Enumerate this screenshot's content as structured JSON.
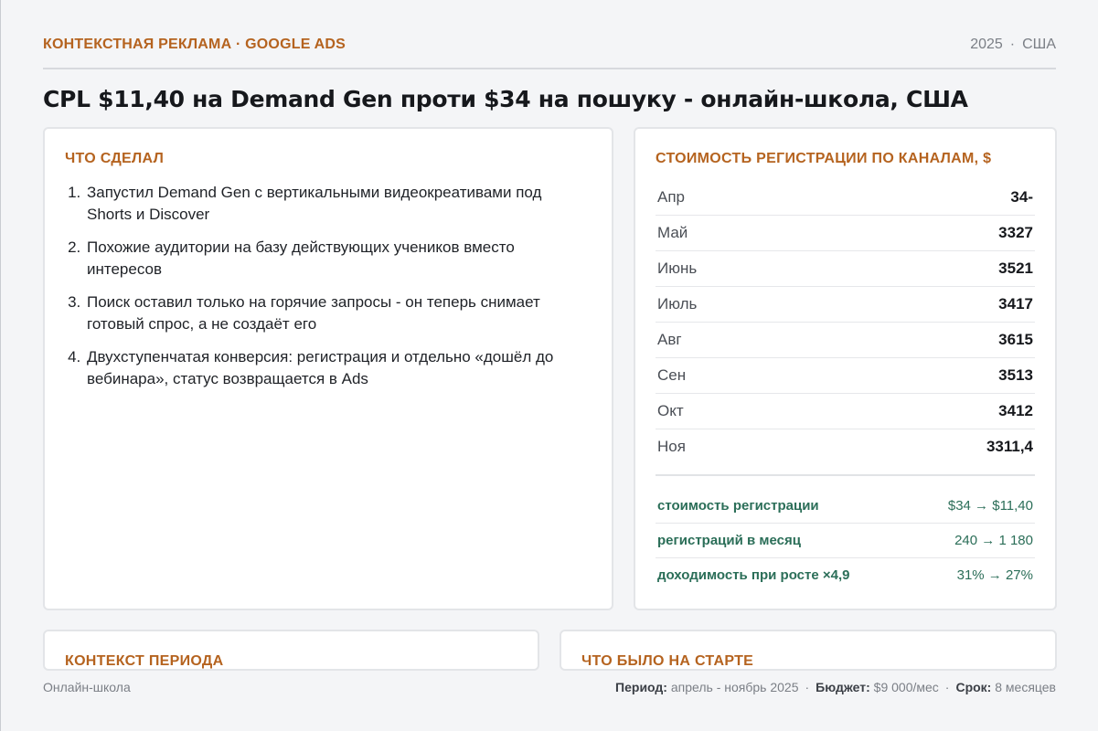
{
  "header": {
    "kicker": "КОНТЕКСТНАЯ РЕКЛАМА · GOOGLE ADS",
    "year": "2025",
    "separator": "·",
    "country": "США"
  },
  "title": "CPL $11,40 на Demand Gen проти $34 на пошуку - онлайн-школа, США",
  "left_card": {
    "heading": "ЧТО СДЕЛАЛ",
    "steps": [
      "Запустил Demand Gen с вертикальными видеокреативами под Shorts и Discover",
      "Похожие аудитории на базу действующих учеников вместо интересов",
      "Поиск оставил только на горячие запросы - он теперь снимает готовый спрос, а не создаёт его",
      "Двухступенчатая конверсия: регистрация и отдельно «дошёл до вебинара», статус возвращается в Ads"
    ]
  },
  "right_card": {
    "heading": "СТОИМОСТЬ РЕГИСТРАЦИИ ПО КАНАЛАМ, $",
    "rows": [
      {
        "month": "Апр",
        "value": "34-"
      },
      {
        "month": "Май",
        "value": "3327"
      },
      {
        "month": "Июнь",
        "value": "3521"
      },
      {
        "month": "Июль",
        "value": "3417"
      },
      {
        "month": "Авг",
        "value": "3615"
      },
      {
        "month": "Сен",
        "value": "3513"
      },
      {
        "month": "Окт",
        "value": "3412"
      },
      {
        "month": "Ноя",
        "value": "3311,4"
      }
    ],
    "kpis": [
      {
        "label": "стоимость регистрации",
        "value": "$34 → $11,40"
      },
      {
        "label": "регистраций в месяц",
        "value": "240 → 1 180"
      },
      {
        "label": "доходимость при росте ×4,9",
        "value": "31% → 27%"
      }
    ]
  },
  "bottom_left": {
    "heading": "КОНТЕКСТ ПЕРИОДА"
  },
  "bottom_right": {
    "heading": "ЧТО БЫЛО НА СТАРТЕ"
  },
  "footer": {
    "niche": "Онлайн-школа",
    "period_label": "Период:",
    "period_value": "апрель - ноябрь 2025",
    "budget_label": "Бюджет:",
    "budget_value": "$9 000/мес",
    "term_label": "Срок:",
    "term_value": "8 месяцев",
    "separator": "·"
  },
  "colors": {
    "accent": "#b5631f",
    "kpi_green": "#2b6e58",
    "background": "#f4f5f7"
  }
}
